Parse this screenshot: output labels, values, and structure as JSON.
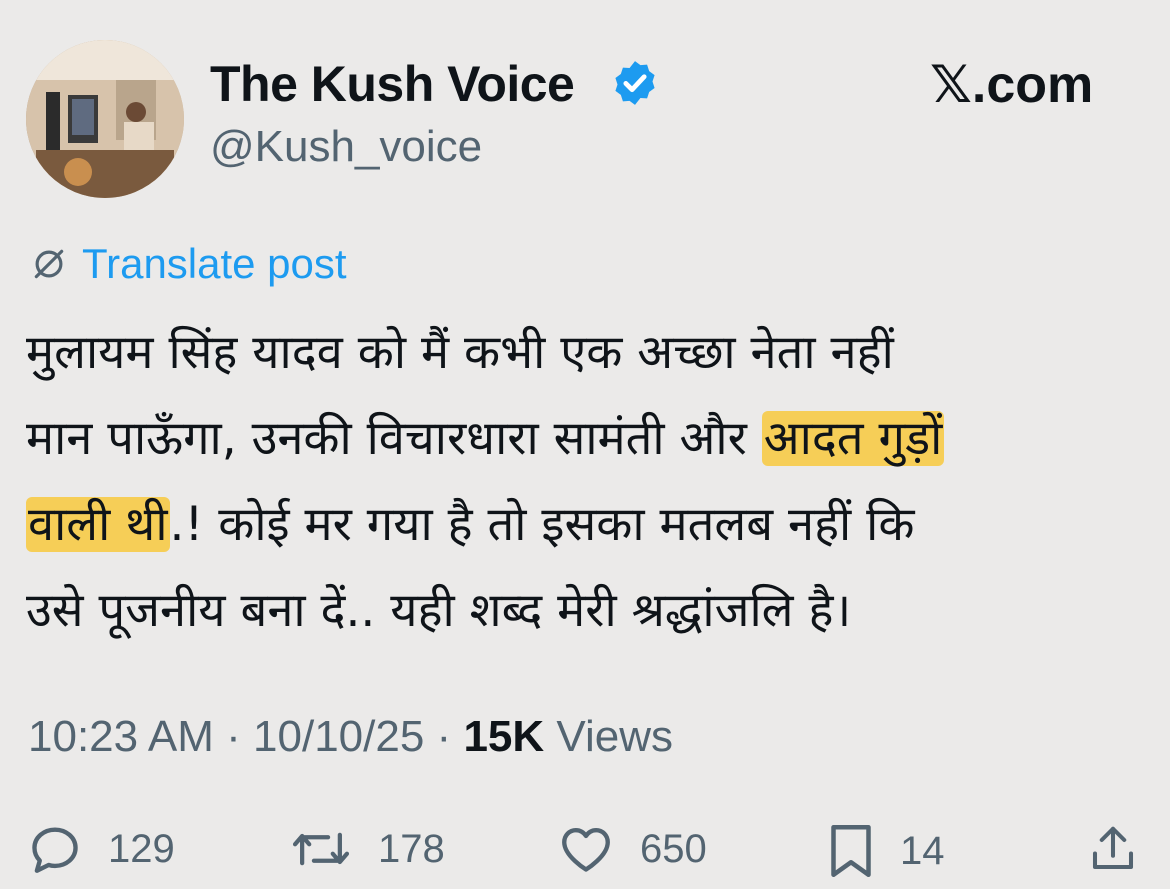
{
  "header": {
    "display_name": "The Kush Voice",
    "handle": "@Kush_voice",
    "site_badge": ".com",
    "site_badge_icon": "x-logo-icon",
    "verified_color": "#1d9bf0"
  },
  "translate": {
    "label": "Translate post",
    "icon": "globe-icon"
  },
  "post": {
    "line1": "मुलायम सिंह यादव को मैं कभी एक अच्छा नेता नहीं",
    "line2_a": "मान पाऊँगा, उनकी विचारधारा सामंती और ",
    "line2_b": "आदत गुड़ों",
    "line3_a": "वाली थी",
    "line3_b": ".! कोई मर गया है तो इसका मतलब नहीं कि",
    "line4": "उसे पूजनीय बना दें.. यही शब्द मेरी श्रद्धांजलि है।",
    "highlight_color": "#f9c33a"
  },
  "meta": {
    "time": "10:23 AM",
    "date": "10/10/25",
    "views_count": "15K",
    "views_label": "Views",
    "separator": "·"
  },
  "actions": {
    "replies": "129",
    "reposts": "178",
    "likes": "650",
    "bookmarks": "14"
  }
}
